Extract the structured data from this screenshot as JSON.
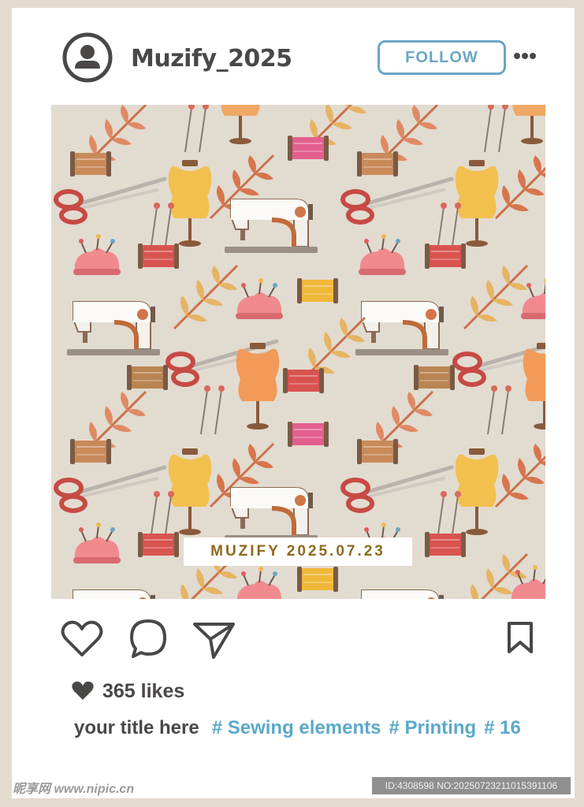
{
  "post": {
    "username": "Muzify_2025",
    "follow_label": "FOLLOW",
    "watermark_text": "MUZIFY 2025.07.23",
    "likes_count": "365 likes",
    "caption_title": "your title here",
    "hashtags": [
      "# Sewing elements",
      "# Printing",
      "# 16"
    ]
  },
  "footer": {
    "site_logo": "昵享网 www.nipic.cn",
    "image_id": "ID:4308598 NO:20250723211015391106"
  },
  "icons": {
    "avatar": "user-avatar-icon",
    "more": "more-horizontal-icon",
    "like": "heart-outline-icon",
    "comment": "comment-bubble-icon",
    "share": "paper-plane-icon",
    "save": "bookmark-icon",
    "likes": "heart-filled-icon"
  },
  "colors": {
    "frame": "#e4dbcf",
    "card": "#ffffff",
    "text_dark": "#4a4746",
    "accent_blue": "#6aa7c4",
    "hashtag": "#5aa9c9",
    "watermark_gold": "#8a6a1f",
    "pattern_bg": "#e2dbd0"
  }
}
